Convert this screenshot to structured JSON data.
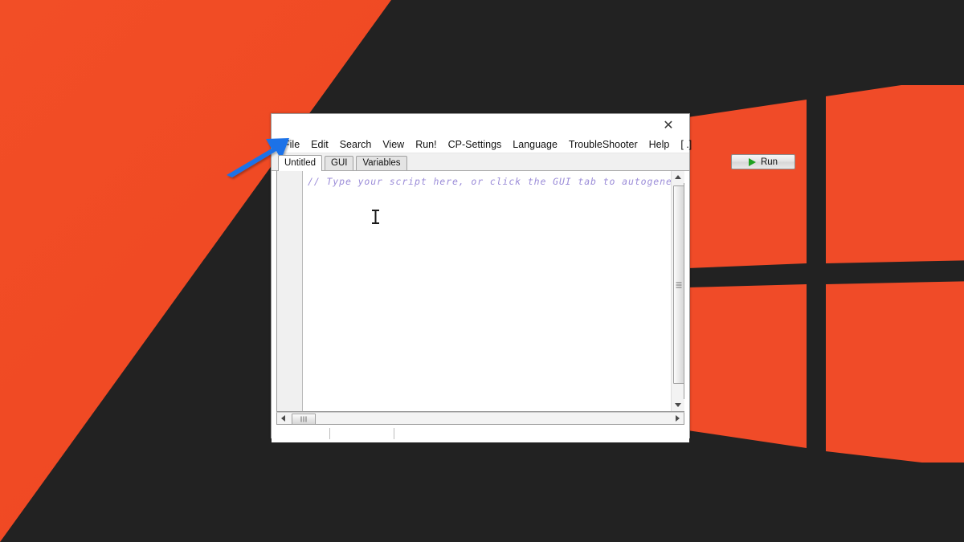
{
  "desktop": {
    "wallpaper": {
      "name": "windows-10-logo-wallpaper",
      "background_color": "#222222",
      "accent_color": "#EE4622",
      "logo_color": "#F04B28"
    }
  },
  "window": {
    "title": "",
    "close_label": "✕",
    "menubar": {
      "items": [
        {
          "label": "File"
        },
        {
          "label": "Edit"
        },
        {
          "label": "Search"
        },
        {
          "label": "View"
        },
        {
          "label": "Run!"
        },
        {
          "label": "CP-Settings"
        },
        {
          "label": "Language"
        },
        {
          "label": "TroubleShooter"
        },
        {
          "label": "Help"
        },
        {
          "label": "[ .]"
        }
      ]
    },
    "tabs": [
      {
        "label": "Untitled",
        "active": true
      },
      {
        "label": "GUI",
        "active": false
      },
      {
        "label": "Variables",
        "active": false
      }
    ],
    "toolbar": {
      "run_label": "Run",
      "run_icon": "play-triangle-icon",
      "run_icon_color": "#1FA01F"
    },
    "editor": {
      "gutter_visible": true,
      "comment_color": "#9B8CD8",
      "lines": [
        "// Type your script here, or click the GUI tab to autogenera"
      ],
      "caret_icon": "text-ibeam-cursor"
    },
    "scrollbars": {
      "vertical": {
        "up_icon": "triangle-up-icon",
        "down_icon": "triangle-down-icon",
        "thumb_grip_icon": "grip-lines-icon"
      },
      "horizontal": {
        "left_icon": "triangle-left-icon",
        "right_icon": "triangle-right-icon",
        "thumb_grip_icon": "grip-lines-icon"
      }
    },
    "statusbar": {
      "cells": [
        "",
        "",
        ""
      ]
    }
  },
  "annotation": {
    "arrow": {
      "name": "pointer-arrow-annotation",
      "color": "#1B72E8",
      "points_to": "File"
    }
  }
}
